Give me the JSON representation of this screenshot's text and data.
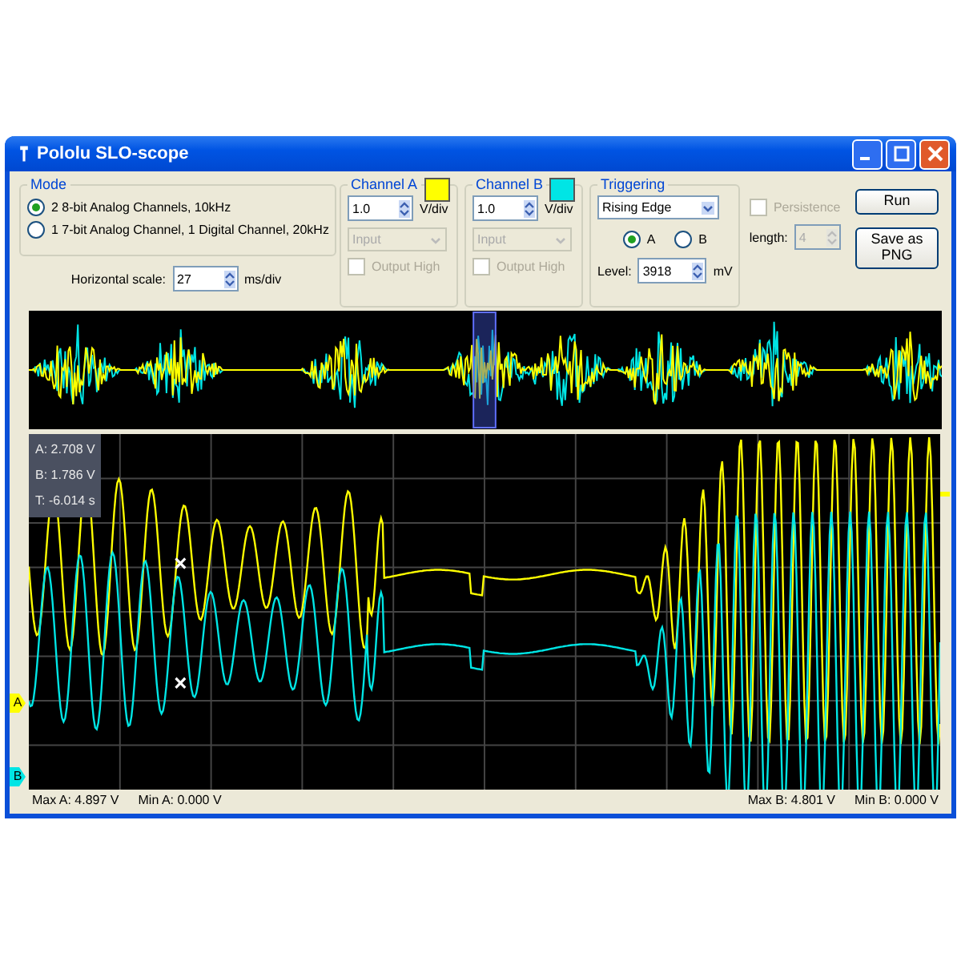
{
  "window": {
    "title": "Pololu SLO-scope"
  },
  "mode": {
    "title": "Mode",
    "options": [
      {
        "label": "2 8-bit Analog Channels, 10kHz",
        "selected": true
      },
      {
        "label": "1 7-bit Analog Channel, 1 Digital Channel, 20kHz",
        "selected": false
      }
    ],
    "horizontal_scale": {
      "label": "Horizontal scale:",
      "value": "27",
      "unit": "ms/div"
    }
  },
  "channels": [
    {
      "title": "Channel A",
      "color": "#ffff00",
      "volts": "1.0",
      "unit": "V/div",
      "input": "Input",
      "input_disabled": true,
      "output_high": {
        "label": "Output High",
        "checked": false,
        "disabled": true
      },
      "marker": "A"
    },
    {
      "title": "Channel B",
      "color": "#00e5e5",
      "volts": "1.0",
      "unit": "V/div",
      "input": "Input",
      "input_disabled": true,
      "output_high": {
        "label": "Output High",
        "checked": false,
        "disabled": true
      },
      "marker": "B"
    }
  ],
  "triggering": {
    "title": "Triggering",
    "edge": "Rising Edge",
    "sources": [
      {
        "label": "A",
        "selected": true
      },
      {
        "label": "B",
        "selected": false
      }
    ],
    "level_label": "Level:",
    "level": "3918",
    "level_unit": "mV"
  },
  "persistence": {
    "label": "Persistence",
    "checked": false,
    "disabled": true,
    "length_label": "length:",
    "length": "4"
  },
  "buttons": [
    "Run",
    "Save as PNG"
  ],
  "readout": [
    "A: 2.708 V",
    "B: 1.786 V",
    "T: -6.014 s"
  ],
  "footer": {
    "left": [
      "Max A: 4.897 V",
      "Min A: 0.000 V"
    ],
    "right": [
      "Max B: 4.801 V",
      "Min B: 0.000 V"
    ]
  }
}
